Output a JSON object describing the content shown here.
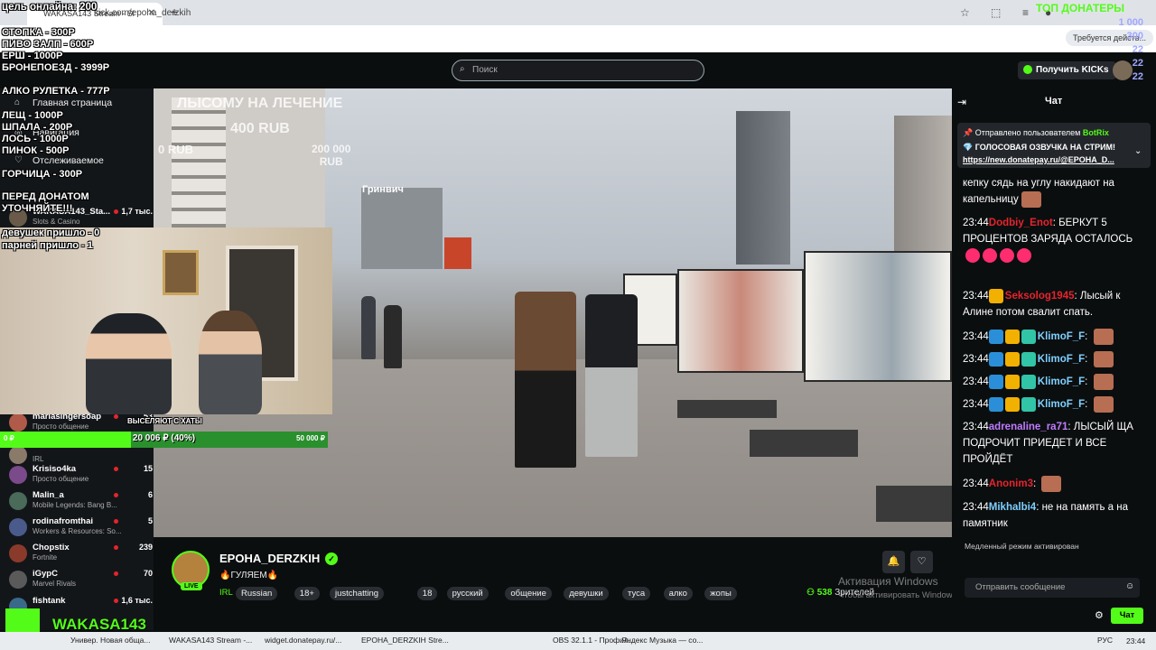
{
  "browser": {
    "tab_title": "WAKASA143 Stream - Sl",
    "url": "kick.com/epoha_derzkih",
    "update_label": "Требуется действ..."
  },
  "header": {
    "search_placeholder": "Поиск",
    "get_kicks_label": "Получить KICKs"
  },
  "overlay": {
    "goal_online": "цель онлайна: 200",
    "price_list": [
      "СТОПКА - 300Р",
      "ПИВО ЗАЛП - 600Р",
      "ЕРШ - 1000Р",
      "БРОНЕПОЕЗД - 3999Р",
      "АЛКО РУЛЕТКА - 777Р",
      "ЛЕЩ - 1000Р",
      "ШПАЛА - 200Р",
      "ЛОСЬ - 1000Р",
      "ПИНОК - 500Р",
      "ГОРЧИЦА - 300Р"
    ],
    "warning": "ПЕРЕД ДОНАТОМ\nУТОЧНЯЙТЕ!!!",
    "girls_count": "девушек пришло - 0",
    "guys_count": "парней пришло - 1",
    "top_donators_title": "ТОП ДОНАТЕРЫ",
    "top_donators_values": [
      "1 000",
      "300",
      "22",
      "22",
      "22"
    ],
    "progress_label": "20 006 ₽ (40%)",
    "progress_min": "0 ₽",
    "progress_max": "50 000 ₽",
    "progress_fraction": 0.4,
    "evicted_text": "ВЫСЕЛЯЮТ С ХАТЫ",
    "brand_text": "WAKASA143"
  },
  "video_overlay": {
    "donation_goal": "ЛЫСОМУ НА ЛЕЧЕНИЕ",
    "goal_amount": "400 RUB",
    "current_amount": "0 RUB",
    "mid_amount": "200 000\nRUB",
    "store_sign": "Гринвич"
  },
  "sidebar": {
    "home_label": "Главная страница",
    "browse_label": "Навигация",
    "following_label": "Отслеживаемое",
    "channels": [
      {
        "name": "WAKASA143_Sta...",
        "category": "Slots & Casino",
        "count": "1,7 тыс.",
        "color": "#6a5a4a"
      },
      {
        "name": "mariasingersoap",
        "category": "Просто общение",
        "count": "53",
        "color": "#b05a4a"
      },
      {
        "name": "",
        "category": "IRL",
        "count": "",
        "color": "#8a7a6a"
      },
      {
        "name": "Krisiso4ka",
        "category": "Просто общение",
        "count": "15",
        "color": "#7a4a8a"
      },
      {
        "name": "Malin_a",
        "category": "Mobile Legends: Bang B...",
        "count": "6",
        "color": "#4a6a5a"
      },
      {
        "name": "rodinafromthai",
        "category": "Workers & Resources: So...",
        "count": "5",
        "color": "#4a5a8a"
      },
      {
        "name": "Chopstix",
        "category": "Fortnite",
        "count": "239",
        "color": "#8a3a2a"
      },
      {
        "name": "iGypC",
        "category": "Marvel Rivals",
        "count": "70",
        "color": "#5a5a5a"
      },
      {
        "name": "fishtank",
        "category": "",
        "count": "1,6 тыс.",
        "color": "#3a6a8a"
      }
    ]
  },
  "stream": {
    "streamer_name": "EPOHA_DERZKIH",
    "live_label": "LIVE",
    "title": "🔥ГУЛЯЕМ🔥",
    "category": "IRL",
    "tags": [
      "Russian",
      "18+",
      "justchatting",
      "18",
      "русский",
      "общение",
      "девушки",
      "туса",
      "алко",
      "жопы"
    ],
    "viewers_count": "538",
    "viewers_label": "Зрителей",
    "windows_activation_title": "Активация Windows",
    "windows_activation_sub": "Чтобы активировать Windows, перейдите в раздел \"Параметры\"."
  },
  "chat": {
    "title": "Чат",
    "pinned_by": "Отправлено пользователем",
    "pinned_user": "BotRix",
    "pinned_text": "ГОЛОСОВАЯ ОЗВУЧКА НА СТРИМ!",
    "pinned_link": "https://new.donatepay.ru/@EPOHA_D...",
    "messages": [
      {
        "time": "",
        "user": "",
        "color": "#fff",
        "text": "кепку сядь на углу накидают на капельницу"
      },
      {
        "time": "23:44",
        "user": "Dodbiy_Enot",
        "color": "#e5242d",
        "text": "БЕРКУТ 5 ПРОЦЕНТОВ ЗАРЯДА ОСТАЛОСЬ"
      },
      {
        "time": "23:44",
        "user": "Seksolog1945",
        "color": "#e5242d",
        "text": "Лысый к Алине потом свалит спать."
      },
      {
        "time": "23:44",
        "user": "KlimoF_F",
        "color": "#7fd0ff",
        "text": ""
      },
      {
        "time": "23:44",
        "user": "KlimoF_F",
        "color": "#7fd0ff",
        "text": ""
      },
      {
        "time": "23:44",
        "user": "KlimoF_F",
        "color": "#7fd0ff",
        "text": ""
      },
      {
        "time": "23:44",
        "user": "KlimoF_F",
        "color": "#7fd0ff",
        "text": ""
      },
      {
        "time": "23:44",
        "user": "adrenaline_ra71",
        "color": "#c07bff",
        "text": "ЛЫСЫЙ ЩА ПОДРОЧИТ ПРИЕДЕТ И ВСЕ ПРОЙДЁТ"
      },
      {
        "time": "23:44",
        "user": "Anonim3",
        "color": "#e5242d",
        "text": ""
      },
      {
        "time": "23:44",
        "user": "Mikhalbi4",
        "color": "#7fd0ff",
        "text": "не на память а на памятник"
      }
    ],
    "slowmode_label": "Медленный режим активирован",
    "input_placeholder": "Отправить сообщение",
    "send_label": "Чат"
  },
  "taskbar": {
    "items": [
      "Универ. Новая обща...",
      "WAKASA143 Stream -...",
      "widget.donatepay.ru/...",
      "EPOHA_DERZKIH Stre...",
      "OBS 32.1.1 - Профил...",
      "Яндекс Музыка — со..."
    ],
    "lang": "РУС",
    "time": "23:44"
  }
}
